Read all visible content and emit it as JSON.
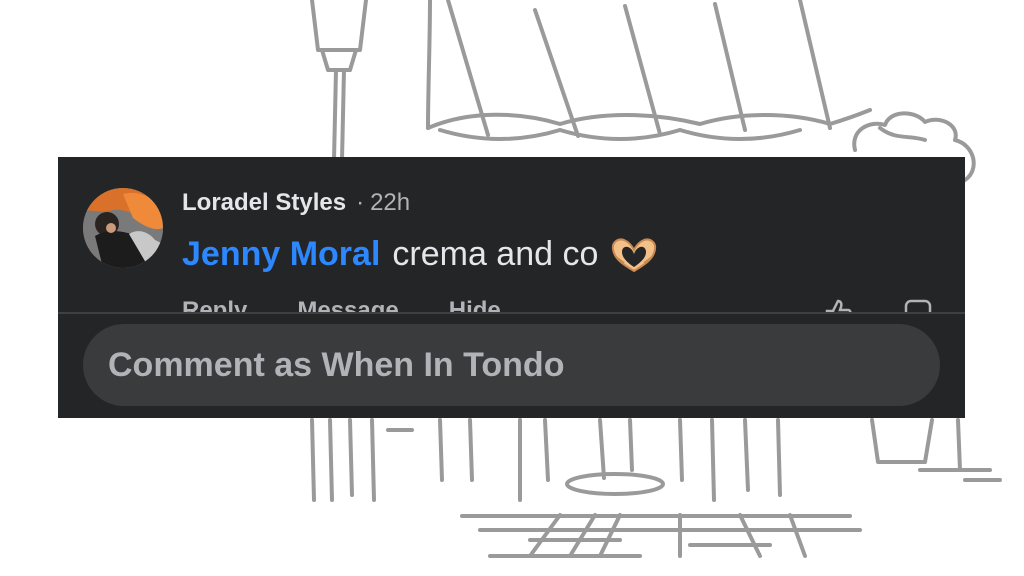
{
  "comment": {
    "author": "Loradel Styles",
    "separator": "·",
    "time": "22h",
    "mention": "Jenny Moral",
    "text": "crema and co",
    "emoji_icon": "heart-hands-icon"
  },
  "actions": {
    "reply": "Reply",
    "message": "Message",
    "hide": "Hide"
  },
  "composer": {
    "placeholder": "Comment as When In Tondo"
  },
  "colors": {
    "panel": "#242526",
    "input": "#3a3b3c",
    "mention": "#2d88ff",
    "text": "#e4e6eb",
    "muted": "#b0b3b8"
  }
}
